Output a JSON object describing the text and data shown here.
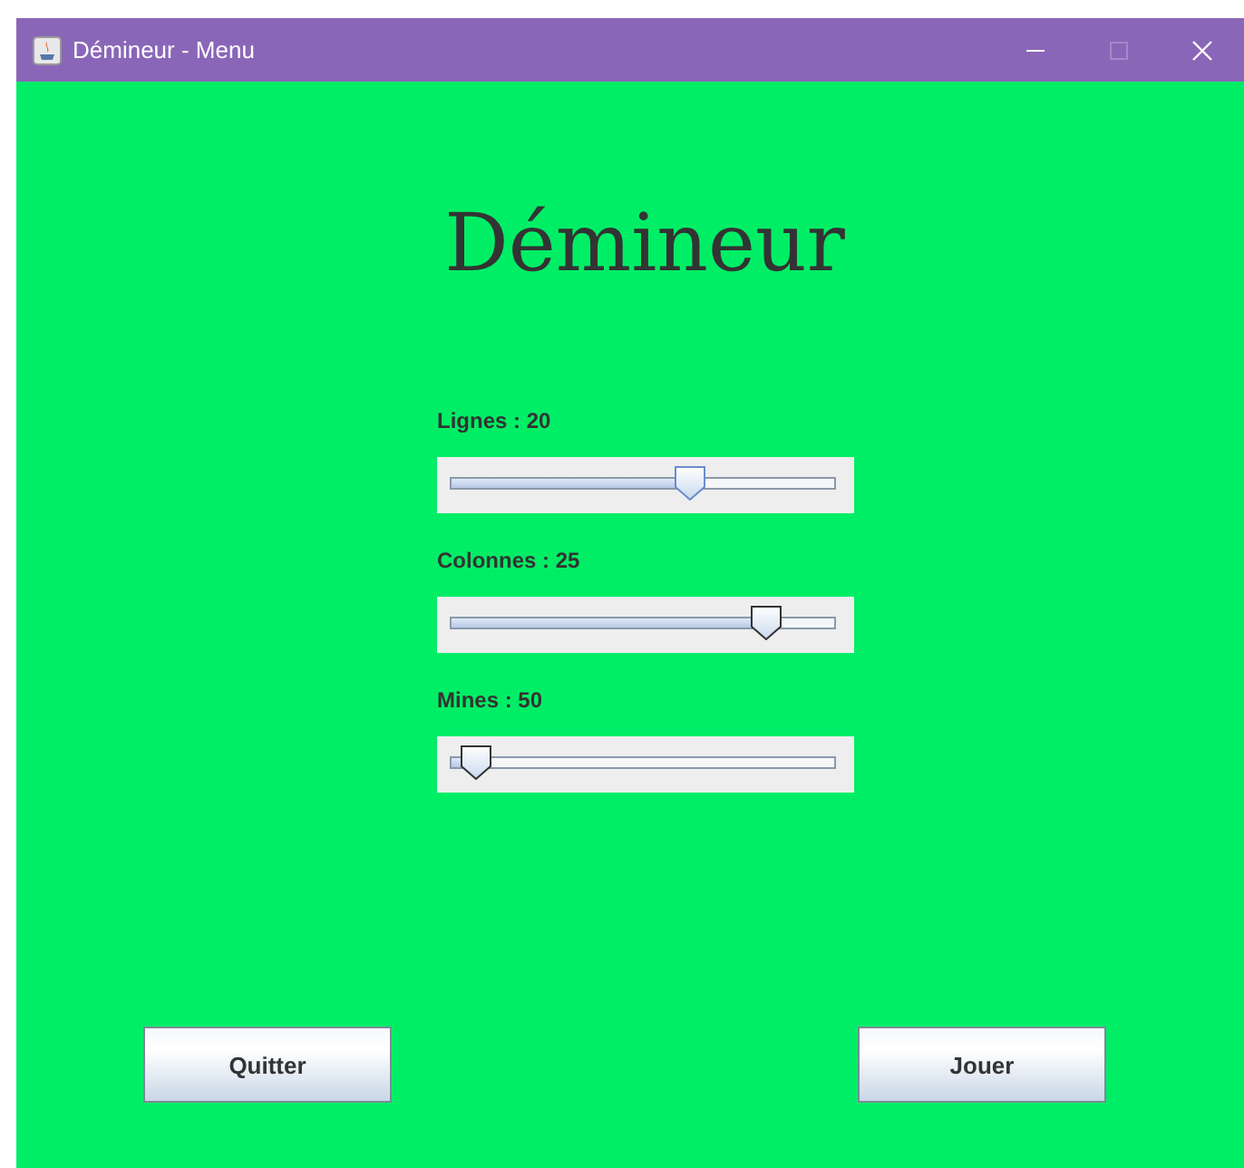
{
  "window": {
    "title": "Démineur - Menu"
  },
  "heading": "Démineur",
  "sliders": [
    {
      "label": "Lignes : 20",
      "level": 0.62,
      "focused": true
    },
    {
      "label": "Colonnes : 25",
      "level": 0.82,
      "focused": false
    },
    {
      "label": "Mines : 50",
      "level": 0.06,
      "focused": false
    }
  ],
  "buttons": [
    "Quitter",
    "Jouer"
  ]
}
